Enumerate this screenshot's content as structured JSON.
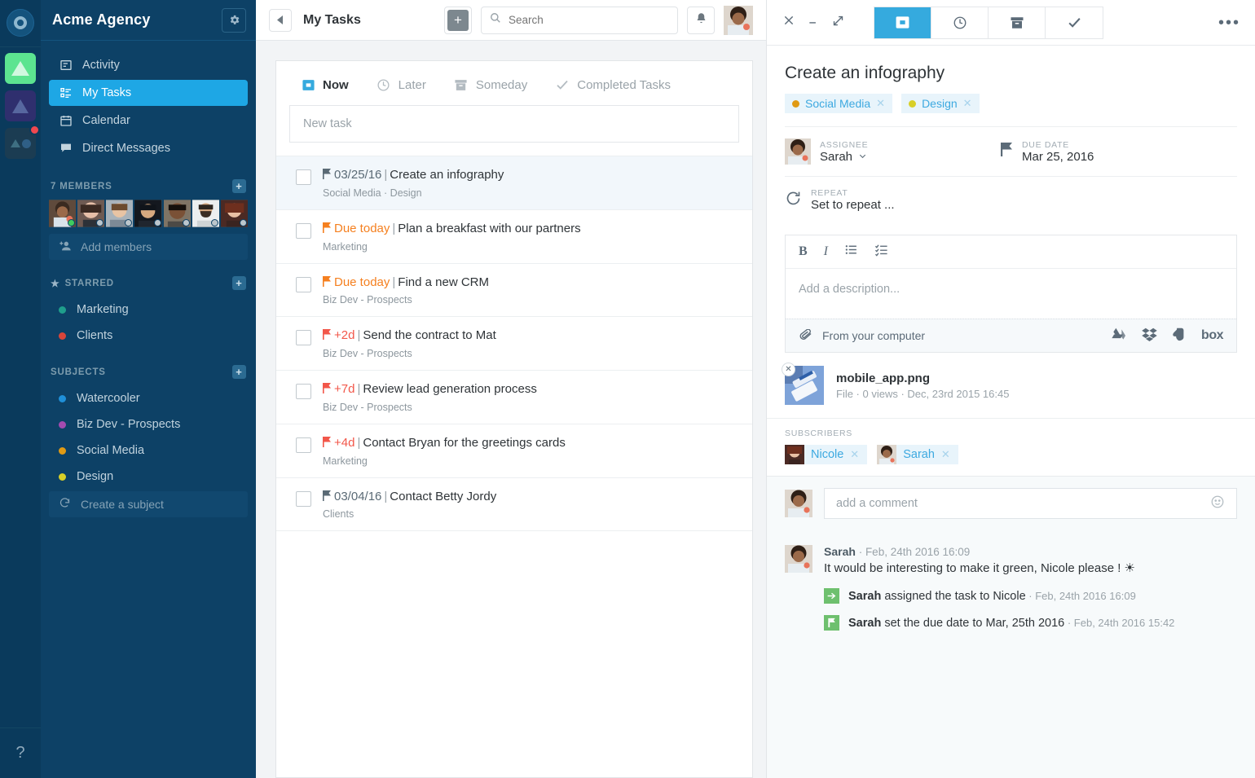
{
  "workspace": {
    "name": "Acme Agency",
    "settings_icon": "gear-icon",
    "logo_icon": "circle-logo-icon"
  },
  "nav": {
    "items": [
      {
        "label": "Activity",
        "icon": "activity-icon",
        "active": false
      },
      {
        "label": "My Tasks",
        "icon": "tasks-icon",
        "active": true
      },
      {
        "label": "Calendar",
        "icon": "calendar-icon",
        "active": false
      },
      {
        "label": "Direct Messages",
        "icon": "chat-icon",
        "active": false
      }
    ]
  },
  "members": {
    "header": "7 MEMBERS",
    "add_label": "Add members",
    "statuses": [
      "online",
      "offline",
      "offline",
      "offline",
      "offline",
      "offline",
      "offline"
    ]
  },
  "starred": {
    "header": "STARRED",
    "items": [
      {
        "label": "Marketing",
        "color": "#1f9e8c"
      },
      {
        "label": "Clients",
        "color": "#d8453a"
      }
    ]
  },
  "subjects": {
    "header": "SUBJECTS",
    "items": [
      {
        "label": "Watercooler",
        "color": "#1f8fd8"
      },
      {
        "label": "Biz Dev - Prospects",
        "color": "#a34bb0"
      },
      {
        "label": "Social Media",
        "color": "#e09a14"
      },
      {
        "label": "Design",
        "color": "#d8cf28"
      }
    ],
    "create_label": "Create a subject"
  },
  "topbar": {
    "back_icon": "chevron-left-icon",
    "title": "My Tasks",
    "add_icon": "plus-icon",
    "search_placeholder": "Search",
    "search_value": "",
    "bell_icon": "bell-icon",
    "avatar": "user-avatar"
  },
  "tasks_panel": {
    "tabs": [
      {
        "label": "Now",
        "icon": "inbox-icon",
        "active": true
      },
      {
        "label": "Later",
        "icon": "clock-icon",
        "active": false
      },
      {
        "label": "Someday",
        "icon": "archive-icon",
        "active": false
      },
      {
        "label": "Completed Tasks",
        "icon": "check-icon",
        "active": false
      }
    ],
    "new_task_placeholder": "New task",
    "rows": [
      {
        "due": "03/25/16",
        "due_style": "grey",
        "title": "Create an infography",
        "subjects": "Social Media · Design",
        "selected": true
      },
      {
        "due": "Due today",
        "due_style": "orange",
        "title": "Plan a breakfast with our partners",
        "subjects": "Marketing",
        "selected": false
      },
      {
        "due": "Due today",
        "due_style": "orange",
        "title": "Find a new CRM",
        "subjects": "Biz Dev - Prospects",
        "selected": false
      },
      {
        "due": "+2d",
        "due_style": "red",
        "title": "Send the contract to Mat",
        "subjects": "Biz Dev - Prospects",
        "selected": false
      },
      {
        "due": "+7d",
        "due_style": "red",
        "title": "Review lead generation process",
        "subjects": "Biz Dev - Prospects",
        "selected": false
      },
      {
        "due": "+4d",
        "due_style": "red",
        "title": "Contact Bryan for the greetings cards",
        "subjects": "Marketing",
        "selected": false
      },
      {
        "due": "03/04/16",
        "due_style": "grey",
        "title": "Contact Betty Jordy",
        "subjects": "Clients",
        "selected": false
      }
    ]
  },
  "detail": {
    "window_controls": [
      {
        "name": "close-icon",
        "glyph": "✕"
      },
      {
        "name": "minimize-icon",
        "glyph": "—"
      },
      {
        "name": "expand-icon",
        "glyph": "⤢"
      }
    ],
    "tabs": [
      {
        "icon": "inbox-icon",
        "active": true
      },
      {
        "icon": "clock-icon",
        "active": false
      },
      {
        "icon": "archive-icon",
        "active": false
      },
      {
        "icon": "check-icon",
        "active": false
      }
    ],
    "more_icon": "more-horizontal-icon",
    "title": "Create an infography",
    "chips": [
      {
        "label": "Social Media",
        "color": "#e09a14"
      },
      {
        "label": "Design",
        "color": "#d8cf28"
      }
    ],
    "assignee": {
      "label": "ASSIGNEE",
      "value": "Sarah"
    },
    "due_date": {
      "label": "DUE DATE",
      "value": "Mar 25, 2016"
    },
    "repeat": {
      "label": "REPEAT",
      "value": "Set to repeat ..."
    },
    "description": {
      "tools": [
        "B",
        "I",
        "bullet-list-icon",
        "checklist-icon"
      ],
      "placeholder": "Add a description...",
      "upload_label": "From your computer",
      "cloud_services": [
        "google-drive-icon",
        "dropbox-icon",
        "evernote-icon",
        "box-icon"
      ]
    },
    "attachment": {
      "name": "mobile_app.png",
      "meta": "File · 0 views · Dec, 23rd 2015 16:45"
    },
    "subscribers": {
      "label": "SUBSCRIBERS",
      "items": [
        {
          "name": "Nicole"
        },
        {
          "name": "Sarah"
        }
      ]
    },
    "comment_placeholder": "add a comment",
    "feed": [
      {
        "type": "comment",
        "author": "Sarah",
        "time": "Feb, 24th 2016 16:09",
        "text": "It would be interesting to make it green, Nicole please ! ☀"
      },
      {
        "type": "event",
        "icon": "assign-icon",
        "actor": "Sarah",
        "text": " assigned the task to Nicole",
        "time": "Feb, 24th 2016 16:09"
      },
      {
        "type": "event",
        "icon": "flag-icon",
        "actor": "Sarah",
        "text": " set the due date to Mar, 25th 2016",
        "time": "Feb, 24th 2016 15:42"
      }
    ]
  },
  "help": {
    "glyph": "?"
  },
  "colors": {
    "sidebar_bg": "#0d4166",
    "rail_bg": "#0a3a5c",
    "accent_blue": "#1ea7e5",
    "tab_active": "#35aade",
    "orange": "#f58020",
    "red": "#f2574a"
  }
}
